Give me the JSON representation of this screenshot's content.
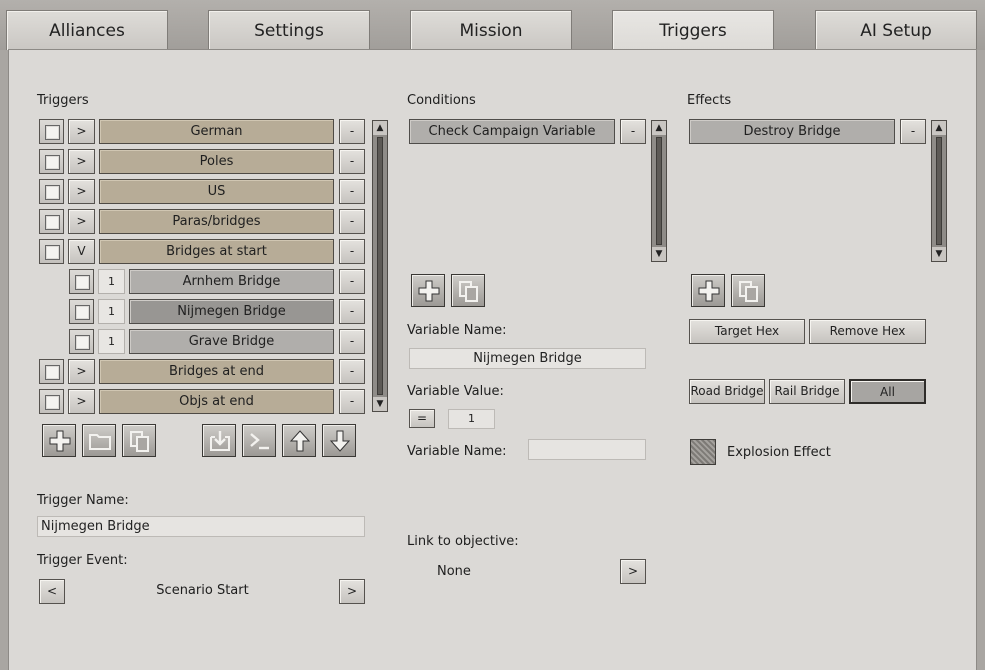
{
  "tabs": [
    {
      "label": "Alliances"
    },
    {
      "label": "Settings"
    },
    {
      "label": "Mission"
    },
    {
      "label": "Triggers"
    },
    {
      "label": "AI Setup"
    }
  ],
  "triggers": {
    "header": "Triggers",
    "groups": [
      {
        "label": "German",
        "toggle": ">"
      },
      {
        "label": "Poles",
        "toggle": ">"
      },
      {
        "label": "US",
        "toggle": ">"
      },
      {
        "label": "Paras/bridges",
        "toggle": ">"
      },
      {
        "label": "Bridges at start",
        "toggle": "V"
      }
    ],
    "sub_items": [
      {
        "label": "Arnhem Bridge",
        "num": "1"
      },
      {
        "label": "Nijmegen Bridge",
        "num": "1"
      },
      {
        "label": "Grave Bridge",
        "num": "1"
      }
    ],
    "groups_after": [
      {
        "label": "Bridges at end",
        "toggle": ">"
      },
      {
        "label": "Objs at end",
        "toggle": ">"
      }
    ],
    "remove_label": "-",
    "trigger_name_label": "Trigger Name:",
    "trigger_name_value": "Nijmegen Bridge",
    "trigger_event_label": "Trigger Event:",
    "trigger_event_value": "Scenario Start",
    "prev_label": "<",
    "next_label": ">"
  },
  "conditions": {
    "header": "Conditions",
    "item": "Check Campaign Variable",
    "remove_label": "-",
    "variable_name_label": "Variable Name:",
    "variable_name_value": "Nijmegen Bridge",
    "variable_value_label": "Variable Value:",
    "operator": "=",
    "value": "1",
    "variable_name2_label": "Variable Name:",
    "variable_name2_value": "",
    "link_label": "Link to objective:",
    "link_value": "None",
    "link_next": ">"
  },
  "effects": {
    "header": "Effects",
    "item": "Destroy Bridge",
    "remove_label": "-",
    "target_hex": "Target Hex",
    "remove_hex": "Remove Hex",
    "road_bridge": "Road Bridge",
    "rail_bridge": "Rail Bridge",
    "all": "All",
    "explosion_label": "Explosion Effect"
  },
  "icons": {
    "add": "plus-icon",
    "folder": "folder-icon",
    "copy": "copy-icon",
    "import": "import-icon",
    "console": "console-icon",
    "up": "arrow-up-icon",
    "down": "arrow-down-icon"
  }
}
